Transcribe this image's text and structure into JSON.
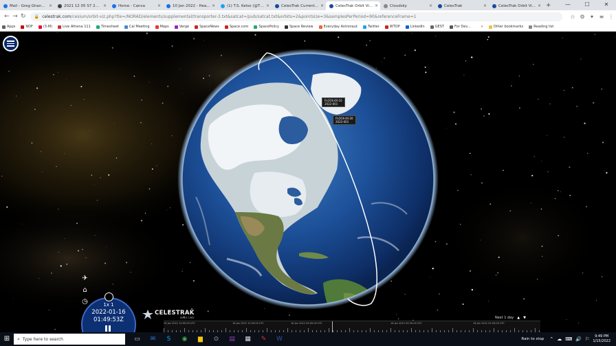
{
  "browser": {
    "tabs": [
      {
        "label": "Mail - Greg Ghanem",
        "color": "#1a73e8"
      },
      {
        "label": "2021 12 05 S7 2...",
        "color": "#444"
      },
      {
        "label": "Home - Canva",
        "color": "#1a73e8"
      },
      {
        "label": "10 Jan 2022 - Hea...",
        "color": "#1a73e8"
      },
      {
        "label": "(1) T.S. Kelso (@TS...",
        "color": "#1da1f2"
      },
      {
        "label": "CelesTrak Current...",
        "color": "#1a4a9a"
      },
      {
        "label": "CelesTrak Orbit Vi...",
        "color": "#1a4a9a",
        "active": true
      },
      {
        "label": "Cloudsky",
        "color": "#888"
      },
      {
        "label": "CelesTrak",
        "color": "#1a4a9a"
      },
      {
        "label": "CelesTrak Orbit Vi...",
        "color": "#1a4a9a"
      }
    ],
    "close_glyph": "×",
    "newtab_glyph": "+",
    "window": {
      "min": "—",
      "max": "☐",
      "close": "✕"
    },
    "nav": {
      "back": "←",
      "forward": "→",
      "reload": "↻"
    },
    "url_lock": "🔒",
    "url_host": "celestrak.com",
    "url_path": "/cesium/orbit-viz.php?tle=/NORAD/elements/supplemental/transporter-3.txt&satcat=/pub/satcat.txt&orbits=2&pointsize=3&samplesPerPeriod=90&referenceFrame=1",
    "right_icons": [
      "☆",
      "⚙",
      "✦",
      "≡",
      "⋮"
    ],
    "bookmarks": [
      {
        "label": "Apps",
        "color": "#5f6368"
      },
      {
        "label": "NDF",
        "color": "#c00"
      },
      {
        "label": "(3-M)",
        "color": "#e03"
      },
      {
        "label": "Live Athena 111",
        "color": "#c33"
      },
      {
        "label": "Timesheet",
        "color": "#2a7"
      },
      {
        "label": "Cal Meeting",
        "color": "#48c"
      },
      {
        "label": "Maps",
        "color": "#e33"
      },
      {
        "label": "Verge",
        "color": "#92c"
      },
      {
        "label": "SpaceNews",
        "color": "#c22"
      },
      {
        "label": "Space.com",
        "color": "#c22"
      },
      {
        "label": "SpacePolicy",
        "color": "#2a6"
      },
      {
        "label": "Space Review",
        "color": "#333"
      },
      {
        "label": "Everyday Astronaut",
        "color": "#e63"
      },
      {
        "label": "Twitter",
        "color": "#1da1f2"
      },
      {
        "label": "WTOP",
        "color": "#c22"
      },
      {
        "label": "LinkedIn",
        "color": "#0a66c2"
      },
      {
        "label": "GEST",
        "color": "#666"
      },
      {
        "label": "For Dev...",
        "color": "#555"
      },
      {
        "label": "»",
        "color": "#fff"
      },
      {
        "label": "Other bookmarks",
        "color": "#f0c040"
      },
      {
        "label": "Reading list",
        "color": "#888"
      }
    ]
  },
  "viewer": {
    "satellites": [
      {
        "name": "FLOCK-4X-10",
        "sub": "2022-001"
      },
      {
        "name": "FLOCK-4X-20",
        "sub": "2022-001"
      }
    ],
    "speed": "1x 1",
    "date": "2022-01-16",
    "time": "01:49:53Z",
    "logo_name": "CELESTRAK",
    "logo_sub": "SINCE 1985",
    "timeline_labels": [
      "16 Jan 2022 10:00:00 UTC",
      "16 Jan 2022 10:30:00 UTC",
      "16 Jan 2022 00:00:00 UTC",
      "16 Jan 2022 00:30:00 UTC",
      "16 Jan 2022 01:00:00 UTC"
    ],
    "timeline_range": "Next 1 day",
    "orbit_color": "#ffffff",
    "background_color": "#000000",
    "menu_color": "#0b2a6b"
  },
  "taskbar": {
    "start": "⊞",
    "search_placeholder": "Type here to search",
    "search_icon": "⌕",
    "apps": [
      {
        "glyph": "▭",
        "color": "#ccc"
      },
      {
        "glyph": "✉",
        "color": "#2a7de1"
      },
      {
        "glyph": "S",
        "color": "#00aff0"
      },
      {
        "glyph": "◉",
        "color": "#4caf50"
      },
      {
        "glyph": "▆",
        "color": "#f5c518"
      },
      {
        "glyph": "⊙",
        "color": "#aaa"
      },
      {
        "glyph": "▤",
        "color": "#8e44ad"
      },
      {
        "glyph": "▦",
        "color": "#ddd"
      },
      {
        "glyph": "✎",
        "color": "#d33"
      },
      {
        "glyph": "W",
        "color": "#2b579a"
      }
    ],
    "tray_text": "Rain to stop",
    "tray_icons": [
      "⌃",
      "☁",
      "⌨",
      "🔊",
      "⚐"
    ],
    "time": "9:49 PM",
    "date": "1/15/2022"
  }
}
